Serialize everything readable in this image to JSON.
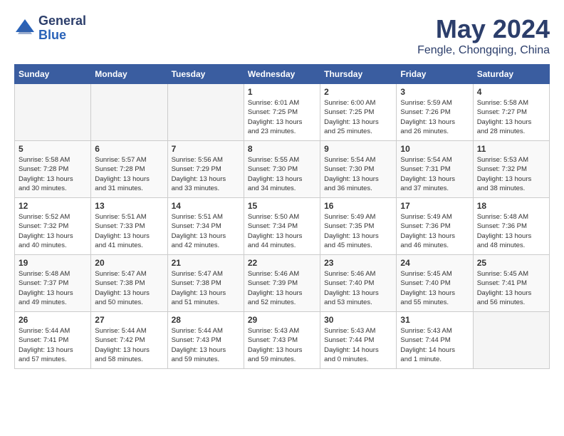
{
  "header": {
    "logo_line1": "General",
    "logo_line2": "Blue",
    "month": "May 2024",
    "location": "Fengle, Chongqing, China"
  },
  "weekdays": [
    "Sunday",
    "Monday",
    "Tuesday",
    "Wednesday",
    "Thursday",
    "Friday",
    "Saturday"
  ],
  "weeks": [
    [
      {
        "day": "",
        "info": ""
      },
      {
        "day": "",
        "info": ""
      },
      {
        "day": "",
        "info": ""
      },
      {
        "day": "1",
        "info": "Sunrise: 6:01 AM\nSunset: 7:25 PM\nDaylight: 13 hours\nand 23 minutes."
      },
      {
        "day": "2",
        "info": "Sunrise: 6:00 AM\nSunset: 7:25 PM\nDaylight: 13 hours\nand 25 minutes."
      },
      {
        "day": "3",
        "info": "Sunrise: 5:59 AM\nSunset: 7:26 PM\nDaylight: 13 hours\nand 26 minutes."
      },
      {
        "day": "4",
        "info": "Sunrise: 5:58 AM\nSunset: 7:27 PM\nDaylight: 13 hours\nand 28 minutes."
      }
    ],
    [
      {
        "day": "5",
        "info": "Sunrise: 5:58 AM\nSunset: 7:28 PM\nDaylight: 13 hours\nand 30 minutes."
      },
      {
        "day": "6",
        "info": "Sunrise: 5:57 AM\nSunset: 7:28 PM\nDaylight: 13 hours\nand 31 minutes."
      },
      {
        "day": "7",
        "info": "Sunrise: 5:56 AM\nSunset: 7:29 PM\nDaylight: 13 hours\nand 33 minutes."
      },
      {
        "day": "8",
        "info": "Sunrise: 5:55 AM\nSunset: 7:30 PM\nDaylight: 13 hours\nand 34 minutes."
      },
      {
        "day": "9",
        "info": "Sunrise: 5:54 AM\nSunset: 7:30 PM\nDaylight: 13 hours\nand 36 minutes."
      },
      {
        "day": "10",
        "info": "Sunrise: 5:54 AM\nSunset: 7:31 PM\nDaylight: 13 hours\nand 37 minutes."
      },
      {
        "day": "11",
        "info": "Sunrise: 5:53 AM\nSunset: 7:32 PM\nDaylight: 13 hours\nand 38 minutes."
      }
    ],
    [
      {
        "day": "12",
        "info": "Sunrise: 5:52 AM\nSunset: 7:32 PM\nDaylight: 13 hours\nand 40 minutes."
      },
      {
        "day": "13",
        "info": "Sunrise: 5:51 AM\nSunset: 7:33 PM\nDaylight: 13 hours\nand 41 minutes."
      },
      {
        "day": "14",
        "info": "Sunrise: 5:51 AM\nSunset: 7:34 PM\nDaylight: 13 hours\nand 42 minutes."
      },
      {
        "day": "15",
        "info": "Sunrise: 5:50 AM\nSunset: 7:34 PM\nDaylight: 13 hours\nand 44 minutes."
      },
      {
        "day": "16",
        "info": "Sunrise: 5:49 AM\nSunset: 7:35 PM\nDaylight: 13 hours\nand 45 minutes."
      },
      {
        "day": "17",
        "info": "Sunrise: 5:49 AM\nSunset: 7:36 PM\nDaylight: 13 hours\nand 46 minutes."
      },
      {
        "day": "18",
        "info": "Sunrise: 5:48 AM\nSunset: 7:36 PM\nDaylight: 13 hours\nand 48 minutes."
      }
    ],
    [
      {
        "day": "19",
        "info": "Sunrise: 5:48 AM\nSunset: 7:37 PM\nDaylight: 13 hours\nand 49 minutes."
      },
      {
        "day": "20",
        "info": "Sunrise: 5:47 AM\nSunset: 7:38 PM\nDaylight: 13 hours\nand 50 minutes."
      },
      {
        "day": "21",
        "info": "Sunrise: 5:47 AM\nSunset: 7:38 PM\nDaylight: 13 hours\nand 51 minutes."
      },
      {
        "day": "22",
        "info": "Sunrise: 5:46 AM\nSunset: 7:39 PM\nDaylight: 13 hours\nand 52 minutes."
      },
      {
        "day": "23",
        "info": "Sunrise: 5:46 AM\nSunset: 7:40 PM\nDaylight: 13 hours\nand 53 minutes."
      },
      {
        "day": "24",
        "info": "Sunrise: 5:45 AM\nSunset: 7:40 PM\nDaylight: 13 hours\nand 55 minutes."
      },
      {
        "day": "25",
        "info": "Sunrise: 5:45 AM\nSunset: 7:41 PM\nDaylight: 13 hours\nand 56 minutes."
      }
    ],
    [
      {
        "day": "26",
        "info": "Sunrise: 5:44 AM\nSunset: 7:41 PM\nDaylight: 13 hours\nand 57 minutes."
      },
      {
        "day": "27",
        "info": "Sunrise: 5:44 AM\nSunset: 7:42 PM\nDaylight: 13 hours\nand 58 minutes."
      },
      {
        "day": "28",
        "info": "Sunrise: 5:44 AM\nSunset: 7:43 PM\nDaylight: 13 hours\nand 59 minutes."
      },
      {
        "day": "29",
        "info": "Sunrise: 5:43 AM\nSunset: 7:43 PM\nDaylight: 13 hours\nand 59 minutes."
      },
      {
        "day": "30",
        "info": "Sunrise: 5:43 AM\nSunset: 7:44 PM\nDaylight: 14 hours\nand 0 minutes."
      },
      {
        "day": "31",
        "info": "Sunrise: 5:43 AM\nSunset: 7:44 PM\nDaylight: 14 hours\nand 1 minute."
      },
      {
        "day": "",
        "info": ""
      }
    ]
  ]
}
